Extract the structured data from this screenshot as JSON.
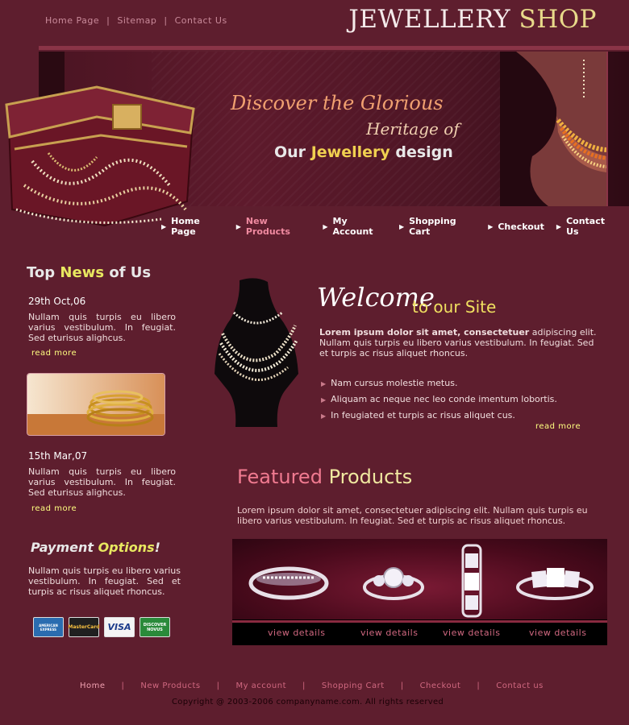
{
  "top_links": [
    "Home Page",
    "Sitemap",
    "Contact Us"
  ],
  "logo": {
    "part1": "JEWELLERY",
    "part2": "SHOP"
  },
  "banner": {
    "line1": "Discover the Glorious",
    "line2": "Heritage of",
    "line3a": "Our",
    "line3b": "Jewellery",
    "line3c": "design"
  },
  "nav": [
    "Home Page",
    "New Products",
    "My Account",
    "Shopping Cart",
    "Checkout",
    "Contact Us"
  ],
  "news": {
    "heading_a": "Top",
    "heading_b": "News",
    "heading_c": "of Us",
    "items": [
      {
        "date": "29th Oct,06",
        "text": "Nullam quis turpis eu libero varius vestibulum. In feugiat. Sed eturisus alighcus.",
        "more": "read more"
      },
      {
        "date": "15th Mar,07",
        "text": "Nullam quis turpis eu libero varius vestibulum. In feugiat. Sed eturisus alighcus.",
        "more": "read more"
      }
    ]
  },
  "payment": {
    "heading_a": "Payment",
    "heading_b": "Options",
    "heading_c": "!",
    "text": "Nullam quis turpis eu libero varius vestibulum. In feugiat. Sed et turpis ac risus aliquet rhoncus.",
    "cards": [
      "AMERICAN EXPRESS",
      "MasterCard",
      "VISA",
      "DISCOVER NOVUS"
    ]
  },
  "welcome": {
    "title_a": "Welcome",
    "title_b": "to our Site",
    "intro_bold": "Lorem ipsum dolor sit amet, consectetuer",
    "intro_rest": " adipiscing elit. Nullam quis turpis eu libero varius vestibulum. In feugiat. Sed et turpis ac risus aliquet rhoncus.",
    "bullets": [
      "Nam cursus molestie metus.",
      "Aliquam ac neque nec leo conde imentum lobortis.",
      "In feugiated et turpis ac risus aliquet cus."
    ],
    "more": "read more"
  },
  "featured": {
    "heading_a": "Featured",
    "heading_b": "Products",
    "text": "Lorem ipsum dolor sit amet, consectetuer adipiscing elit. Nullam quis turpis eu libero varius vestibulum. In feugiat. Sed et turpis ac risus aliquet rhoncus.",
    "details": [
      "view details",
      "view details",
      "view details",
      "view details"
    ]
  },
  "footer": {
    "links": [
      "Home",
      "New Products",
      "My account",
      "Shopping Cart",
      "Checkout",
      "Contact us"
    ],
    "copyright": "Copyright @ 2003-2006 companyname.com. All rights reserved"
  },
  "colors": {
    "bg": "#5e1e2e",
    "accent_yellow": "#f0e060",
    "accent_pink": "#f07a90"
  }
}
